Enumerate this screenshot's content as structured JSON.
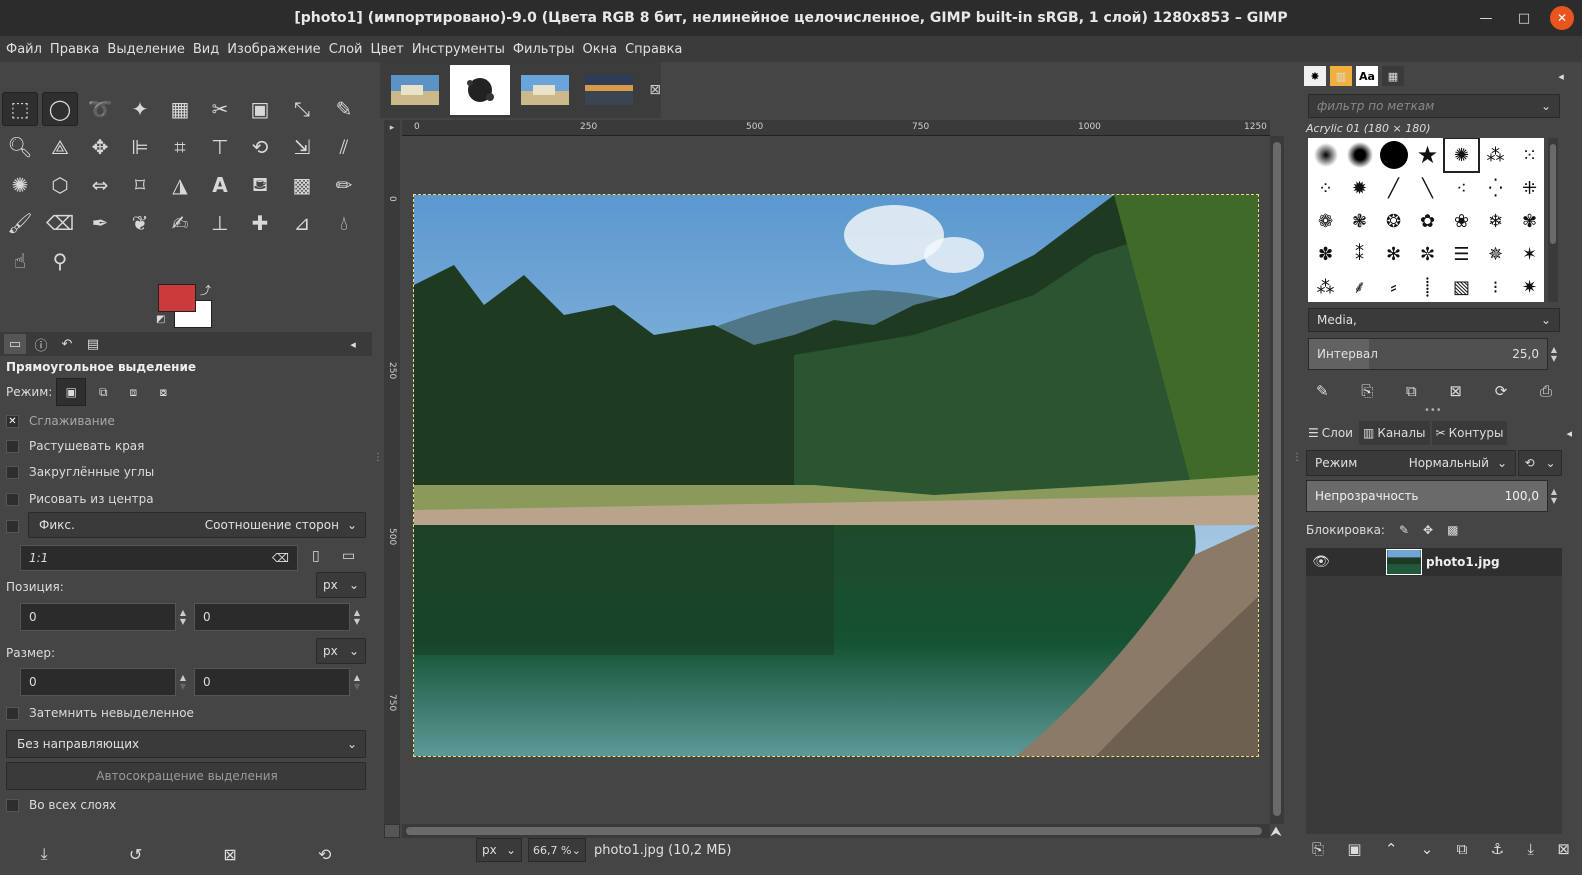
{
  "window": {
    "title": "[photo1] (импортировано)-9.0 (Цвета RGB 8 бит, нелинейное целочисленное, GIMP built-in sRGB, 1 слой) 1280x853 – GIMP"
  },
  "menu": [
    "Файл",
    "Правка",
    "Выделение",
    "Вид",
    "Изображение",
    "Слой",
    "Цвет",
    "Инструменты",
    "Фильтры",
    "Окна",
    "Справка"
  ],
  "colors": {
    "foreground": "#cc3b3b",
    "background": "#ffffff",
    "selection_marquee": "#e8e070"
  },
  "tool_options": {
    "title": "Прямоугольное выделение",
    "mode_label": "Режим:",
    "antialias_label": "Сглаживание",
    "antialias_checked": true,
    "feather_label": "Растушевать края",
    "rounded_label": "Закруглённые углы",
    "from_center_label": "Рисовать из центра",
    "fixed_label": "Фикс.",
    "fixed_mode": "Соотношение сторон",
    "ratio_value": "1:1",
    "position_label": "Позиция:",
    "position_unit": "px",
    "position_x": "0",
    "position_y": "0",
    "size_label": "Размер:",
    "size_unit": "px",
    "size_w": "0",
    "size_h": "0",
    "highlight_label": "Затемнить невыделенное",
    "guides_value": "Без направляющих",
    "autoshrink_label": "Автосокращение выделения",
    "merged_label": "Во всех слоях"
  },
  "image_window": {
    "ruler_ticks": [
      "0",
      "250",
      "500",
      "750",
      "1000",
      "1250"
    ],
    "vruler_ticks": [
      "0",
      "250",
      "500",
      "750"
    ],
    "unit": "px",
    "zoom": "66,7 %",
    "status": "photo1.jpg (10,2 МБ)"
  },
  "brushes": {
    "filter_placeholder": "фильтр по меткам",
    "selected_name": "Acrylic 01 (180 × 180)",
    "category": "Media,",
    "spacing_label": "Интервал",
    "spacing_value": "25,0",
    "spacing_fraction": 0.25
  },
  "layers": {
    "tabs": [
      "Слои",
      "Каналы",
      "Контуры"
    ],
    "mode_label": "Режим",
    "mode_value": "Нормальный",
    "opacity_label": "Непрозрачность",
    "opacity_value": "100,0",
    "lock_label": "Блокировка:",
    "items": [
      {
        "name": "photo1.jpg"
      }
    ]
  }
}
